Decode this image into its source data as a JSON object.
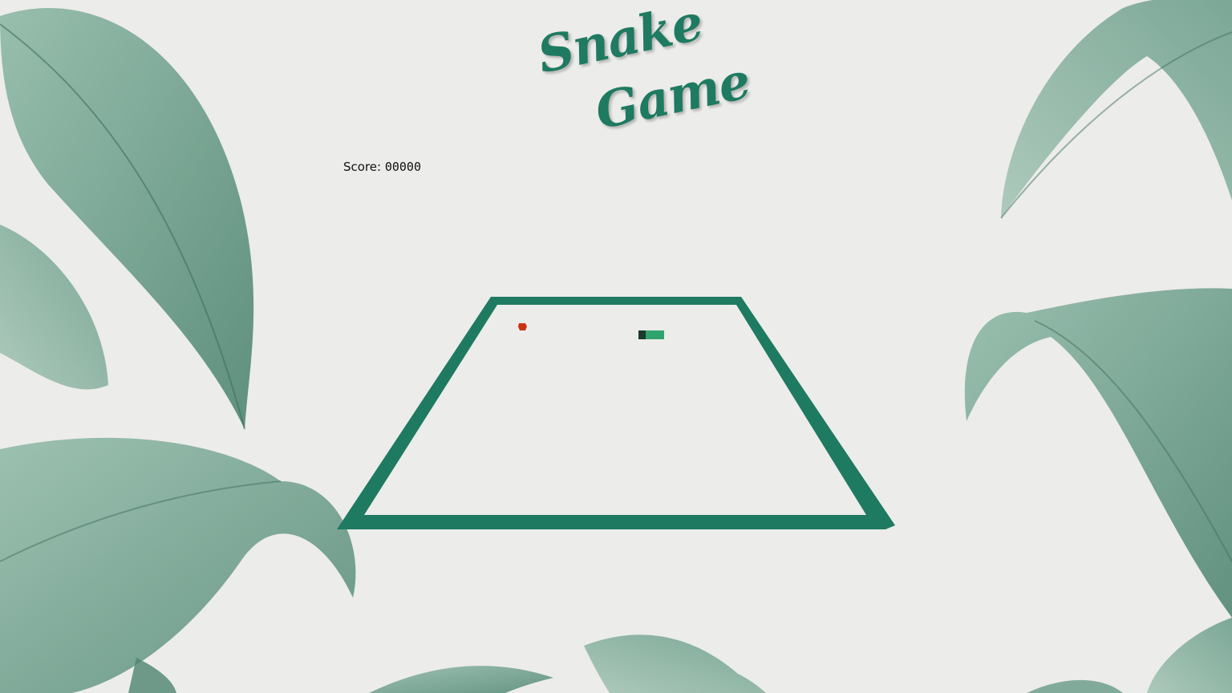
{
  "title": {
    "line1": "Snake",
    "line2": "Game"
  },
  "score": {
    "label": "Score: ",
    "value": "00000"
  },
  "colors": {
    "background": "#ececea",
    "board_border": "#1e7a60",
    "snake_body": "#2fa36b",
    "snake_head": "#1a3b2c",
    "food": "#cc3311",
    "leaf_dark": "#5a8f7b",
    "leaf_light": "#8fb9a7"
  },
  "game": {
    "snake_length": 2,
    "food_count": 1
  }
}
